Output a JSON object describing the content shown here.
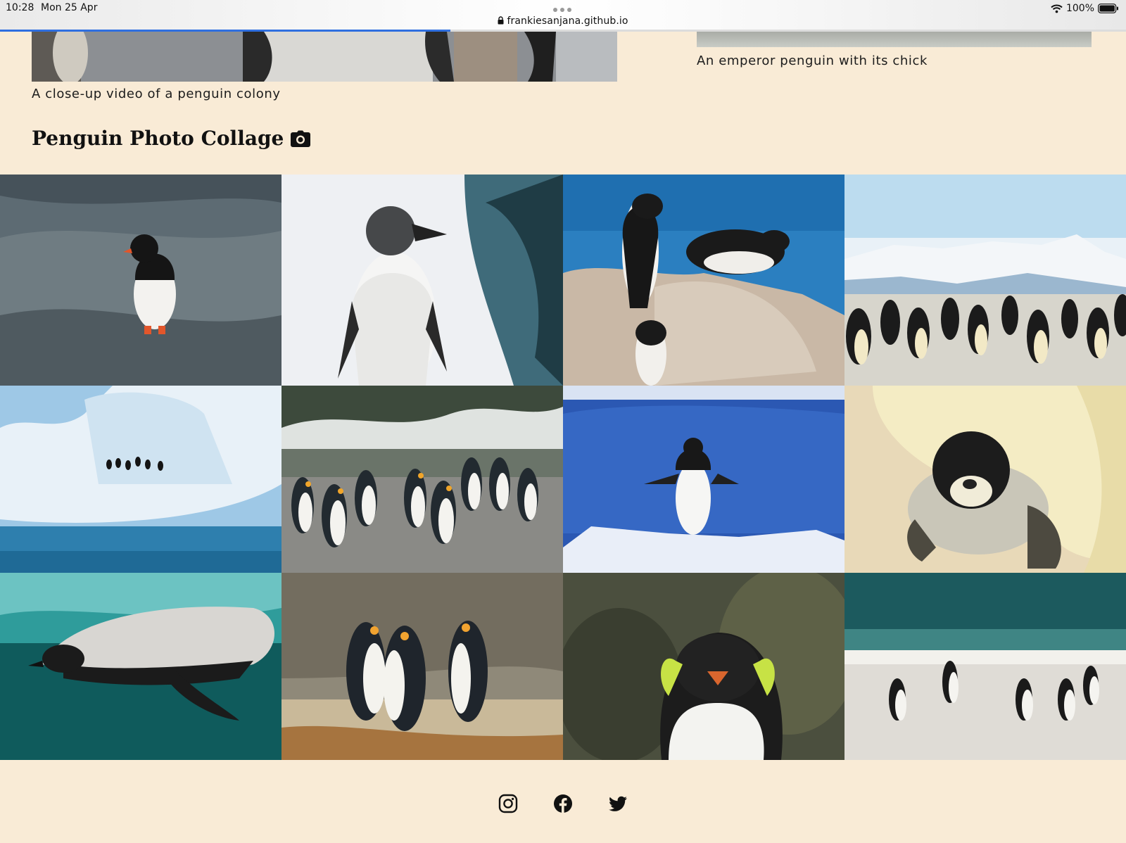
{
  "status_bar": {
    "time": "10:28",
    "date": "Mon 25 Apr",
    "battery": "100%"
  },
  "browser": {
    "url": "frankiesanjana.github.io",
    "load_progress": 0.4
  },
  "media": {
    "video_caption": "A close-up video of a penguin colony",
    "chick_caption": "An emperor penguin with its chick"
  },
  "collage": {
    "title": "Penguin Photo Collage",
    "title_icon": "camera-icon",
    "photos": [
      "gentoo-on-rock",
      "humboldt-in-snow",
      "african-penguins-on-rocks",
      "emperor-colony-mountains",
      "penguins-on-iceberg",
      "king-penguins-walking",
      "adelie-wings-out",
      "emperor-chick",
      "penguin-swimming",
      "king-penguins-group",
      "rockhopper-closeup",
      "gentoos-on-beach"
    ]
  },
  "social": [
    "instagram-icon",
    "facebook-icon",
    "twitter-icon"
  ],
  "colors": {
    "page_bg": "#f9ebd6",
    "progress": "#2f6fe0",
    "text": "#111111"
  }
}
